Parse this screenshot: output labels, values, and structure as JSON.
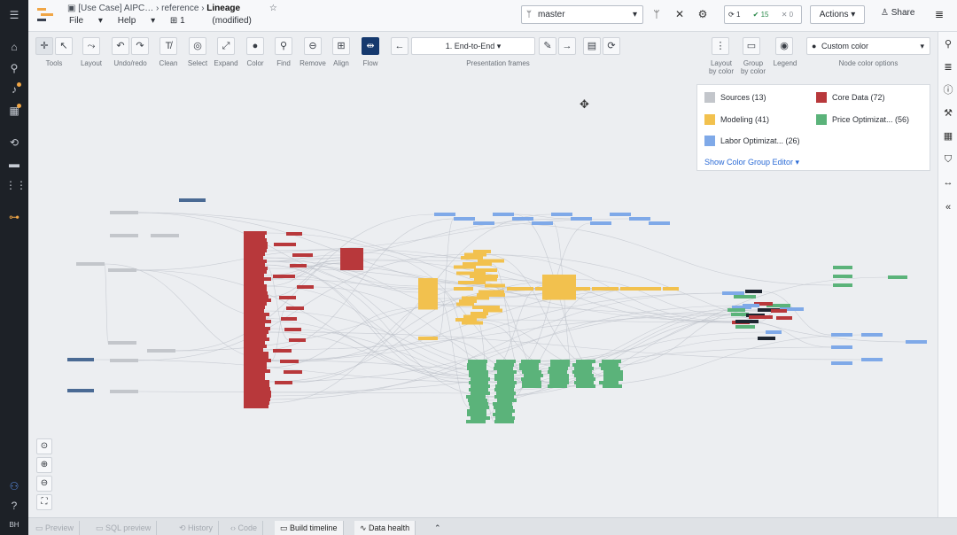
{
  "header": {
    "breadcrumb_project": "[Use Case] AIPC…",
    "breadcrumb_folder": "reference",
    "breadcrumb_page": "Lineage",
    "menu_file": "File",
    "menu_help": "Help",
    "file_count": "1",
    "status": "(modified)",
    "branch": "master",
    "check_1": "1",
    "check_2": "15",
    "check_3": "0",
    "actions": "Actions",
    "share": "Share"
  },
  "toolbar": {
    "tools": "Tools",
    "layout": "Layout",
    "undo_redo": "Undo/redo",
    "clean": "Clean",
    "select": "Select",
    "expand": "Expand",
    "color": "Color",
    "find": "Find",
    "remove": "Remove",
    "align": "Align",
    "flow": "Flow",
    "frame_value": "1. End-to-End",
    "presentation_frames": "Presentation frames",
    "layout_by_color_1": "Layout",
    "layout_by_color_2": "by color",
    "group_by_color_1": "Group",
    "group_by_color_2": "by color",
    "legend": "Legend",
    "node_color_value": "Custom color",
    "node_color_options": "Node color options"
  },
  "legend": {
    "items": [
      {
        "label": "Sources (13)",
        "color": "#c3c6cb"
      },
      {
        "label": "Core Data (72)",
        "color": "#b8383b"
      },
      {
        "label": "Modeling (41)",
        "color": "#f2c14e"
      },
      {
        "label": "Price Optimizat... (56)",
        "color": "#5bb37a"
      },
      {
        "label": "Labor Optimizat... (26)",
        "color": "#7fa9e8"
      }
    ],
    "editor_link": "Show Color Group Editor ▾"
  },
  "bottom_tabs": {
    "preview": "Preview",
    "sql": "SQL preview",
    "history": "History",
    "code": "Code",
    "build_timeline": "Build timeline",
    "data_health": "Data health"
  },
  "colors": {
    "sources": "#c3c6cb",
    "core": "#b8383b",
    "modeling": "#f2c14e",
    "price": "#5bb37a",
    "labor": "#7fa9e8",
    "accent": "#15396e"
  }
}
